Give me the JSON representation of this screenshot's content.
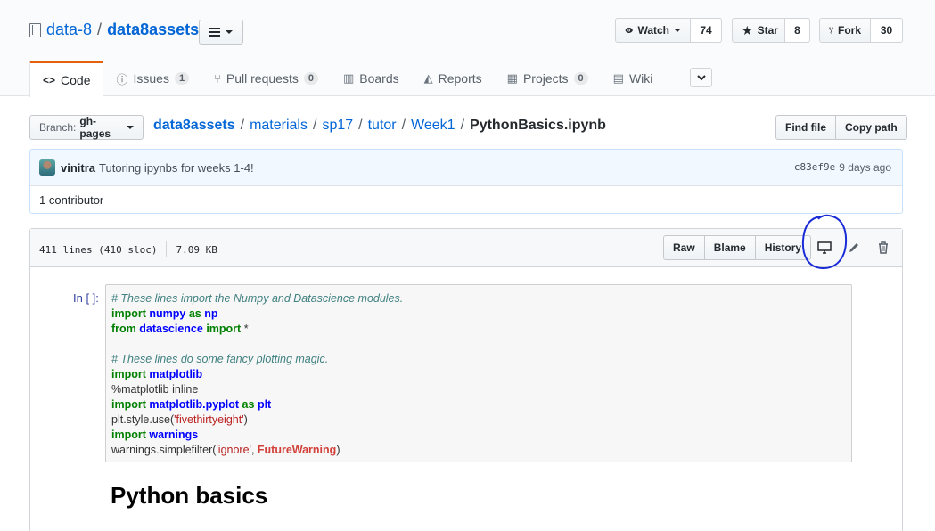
{
  "repo": {
    "owner": "data-8",
    "separator": "/",
    "name": "data8assets"
  },
  "social": {
    "watch": {
      "label": "Watch",
      "count": "74"
    },
    "star": {
      "label": "Star",
      "count": "8"
    },
    "fork": {
      "label": "Fork",
      "count": "30"
    }
  },
  "tabs": [
    {
      "label": "Code",
      "icon": "code-icon"
    },
    {
      "label": "Issues",
      "icon": "issue-icon",
      "badge": "1"
    },
    {
      "label": "Pull requests",
      "icon": "pull-request-icon",
      "badge": "0"
    },
    {
      "label": "Boards",
      "icon": "boards-icon"
    },
    {
      "label": "Reports",
      "icon": "graph-icon"
    },
    {
      "label": "Projects",
      "icon": "project-icon",
      "badge": "0"
    },
    {
      "label": "Wiki",
      "icon": "book-icon"
    }
  ],
  "branch": {
    "label": "Branch:",
    "value": "gh-pages"
  },
  "breadcrumb": {
    "parts": [
      "data8assets",
      "materials",
      "sp17",
      "tutor",
      "Week1"
    ],
    "file": "PythonBasics.ipynb",
    "sep": "/"
  },
  "file_nav": {
    "find_file": "Find file",
    "copy_path": "Copy path"
  },
  "commit": {
    "author": "vinitra",
    "message": "Tutoring ipynbs for weeks 1-4!",
    "sha": "c83ef9e",
    "time": "9 days ago"
  },
  "contributors": "1 contributor",
  "file_info": {
    "lines": "411 lines (410 sloc)",
    "size": "7.09 KB"
  },
  "file_actions": {
    "raw": "Raw",
    "blame": "Blame",
    "history": "History"
  },
  "notebook": {
    "prompt": "In [ ]:",
    "heading": "Python basics"
  },
  "colors": {
    "link": "#0366d6",
    "tab_accent": "#e36209",
    "annotation": "#1a2bd8"
  }
}
